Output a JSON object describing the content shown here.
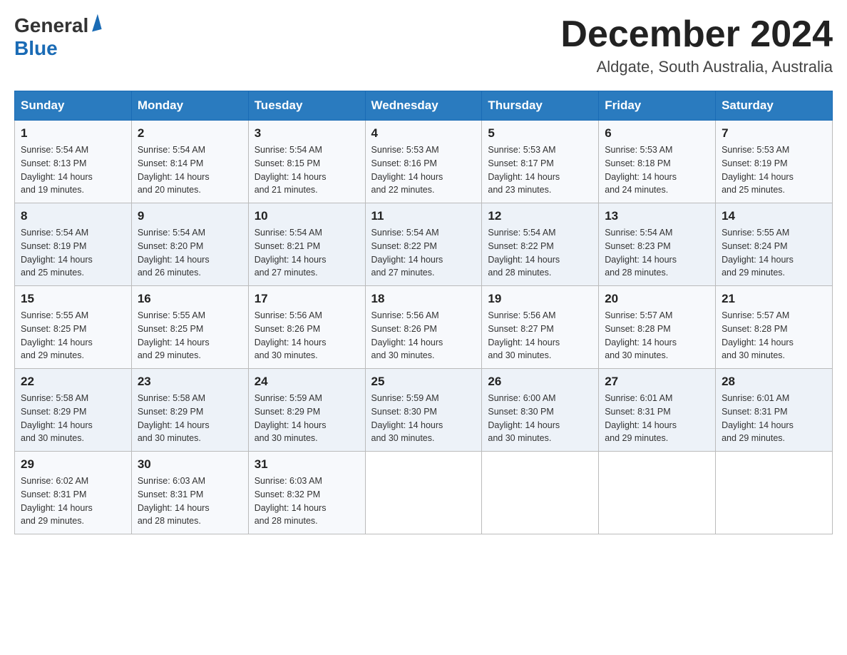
{
  "header": {
    "logo": {
      "general": "General",
      "blue": "Blue"
    },
    "title": "December 2024",
    "location": "Aldgate, South Australia, Australia"
  },
  "weekdays": [
    "Sunday",
    "Monday",
    "Tuesday",
    "Wednesday",
    "Thursday",
    "Friday",
    "Saturday"
  ],
  "weeks": [
    [
      {
        "day": "1",
        "sunrise": "5:54 AM",
        "sunset": "8:13 PM",
        "daylight": "14 hours and 19 minutes."
      },
      {
        "day": "2",
        "sunrise": "5:54 AM",
        "sunset": "8:14 PM",
        "daylight": "14 hours and 20 minutes."
      },
      {
        "day": "3",
        "sunrise": "5:54 AM",
        "sunset": "8:15 PM",
        "daylight": "14 hours and 21 minutes."
      },
      {
        "day": "4",
        "sunrise": "5:53 AM",
        "sunset": "8:16 PM",
        "daylight": "14 hours and 22 minutes."
      },
      {
        "day": "5",
        "sunrise": "5:53 AM",
        "sunset": "8:17 PM",
        "daylight": "14 hours and 23 minutes."
      },
      {
        "day": "6",
        "sunrise": "5:53 AM",
        "sunset": "8:18 PM",
        "daylight": "14 hours and 24 minutes."
      },
      {
        "day": "7",
        "sunrise": "5:53 AM",
        "sunset": "8:19 PM",
        "daylight": "14 hours and 25 minutes."
      }
    ],
    [
      {
        "day": "8",
        "sunrise": "5:54 AM",
        "sunset": "8:19 PM",
        "daylight": "14 hours and 25 minutes."
      },
      {
        "day": "9",
        "sunrise": "5:54 AM",
        "sunset": "8:20 PM",
        "daylight": "14 hours and 26 minutes."
      },
      {
        "day": "10",
        "sunrise": "5:54 AM",
        "sunset": "8:21 PM",
        "daylight": "14 hours and 27 minutes."
      },
      {
        "day": "11",
        "sunrise": "5:54 AM",
        "sunset": "8:22 PM",
        "daylight": "14 hours and 27 minutes."
      },
      {
        "day": "12",
        "sunrise": "5:54 AM",
        "sunset": "8:22 PM",
        "daylight": "14 hours and 28 minutes."
      },
      {
        "day": "13",
        "sunrise": "5:54 AM",
        "sunset": "8:23 PM",
        "daylight": "14 hours and 28 minutes."
      },
      {
        "day": "14",
        "sunrise": "5:55 AM",
        "sunset": "8:24 PM",
        "daylight": "14 hours and 29 minutes."
      }
    ],
    [
      {
        "day": "15",
        "sunrise": "5:55 AM",
        "sunset": "8:25 PM",
        "daylight": "14 hours and 29 minutes."
      },
      {
        "day": "16",
        "sunrise": "5:55 AM",
        "sunset": "8:25 PM",
        "daylight": "14 hours and 29 minutes."
      },
      {
        "day": "17",
        "sunrise": "5:56 AM",
        "sunset": "8:26 PM",
        "daylight": "14 hours and 30 minutes."
      },
      {
        "day": "18",
        "sunrise": "5:56 AM",
        "sunset": "8:26 PM",
        "daylight": "14 hours and 30 minutes."
      },
      {
        "day": "19",
        "sunrise": "5:56 AM",
        "sunset": "8:27 PM",
        "daylight": "14 hours and 30 minutes."
      },
      {
        "day": "20",
        "sunrise": "5:57 AM",
        "sunset": "8:28 PM",
        "daylight": "14 hours and 30 minutes."
      },
      {
        "day": "21",
        "sunrise": "5:57 AM",
        "sunset": "8:28 PM",
        "daylight": "14 hours and 30 minutes."
      }
    ],
    [
      {
        "day": "22",
        "sunrise": "5:58 AM",
        "sunset": "8:29 PM",
        "daylight": "14 hours and 30 minutes."
      },
      {
        "day": "23",
        "sunrise": "5:58 AM",
        "sunset": "8:29 PM",
        "daylight": "14 hours and 30 minutes."
      },
      {
        "day": "24",
        "sunrise": "5:59 AM",
        "sunset": "8:29 PM",
        "daylight": "14 hours and 30 minutes."
      },
      {
        "day": "25",
        "sunrise": "5:59 AM",
        "sunset": "8:30 PM",
        "daylight": "14 hours and 30 minutes."
      },
      {
        "day": "26",
        "sunrise": "6:00 AM",
        "sunset": "8:30 PM",
        "daylight": "14 hours and 30 minutes."
      },
      {
        "day": "27",
        "sunrise": "6:01 AM",
        "sunset": "8:31 PM",
        "daylight": "14 hours and 29 minutes."
      },
      {
        "day": "28",
        "sunrise": "6:01 AM",
        "sunset": "8:31 PM",
        "daylight": "14 hours and 29 minutes."
      }
    ],
    [
      {
        "day": "29",
        "sunrise": "6:02 AM",
        "sunset": "8:31 PM",
        "daylight": "14 hours and 29 minutes."
      },
      {
        "day": "30",
        "sunrise": "6:03 AM",
        "sunset": "8:31 PM",
        "daylight": "14 hours and 28 minutes."
      },
      {
        "day": "31",
        "sunrise": "6:03 AM",
        "sunset": "8:32 PM",
        "daylight": "14 hours and 28 minutes."
      },
      null,
      null,
      null,
      null
    ]
  ],
  "labels": {
    "sunrise": "Sunrise:",
    "sunset": "Sunset:",
    "daylight": "Daylight:"
  }
}
